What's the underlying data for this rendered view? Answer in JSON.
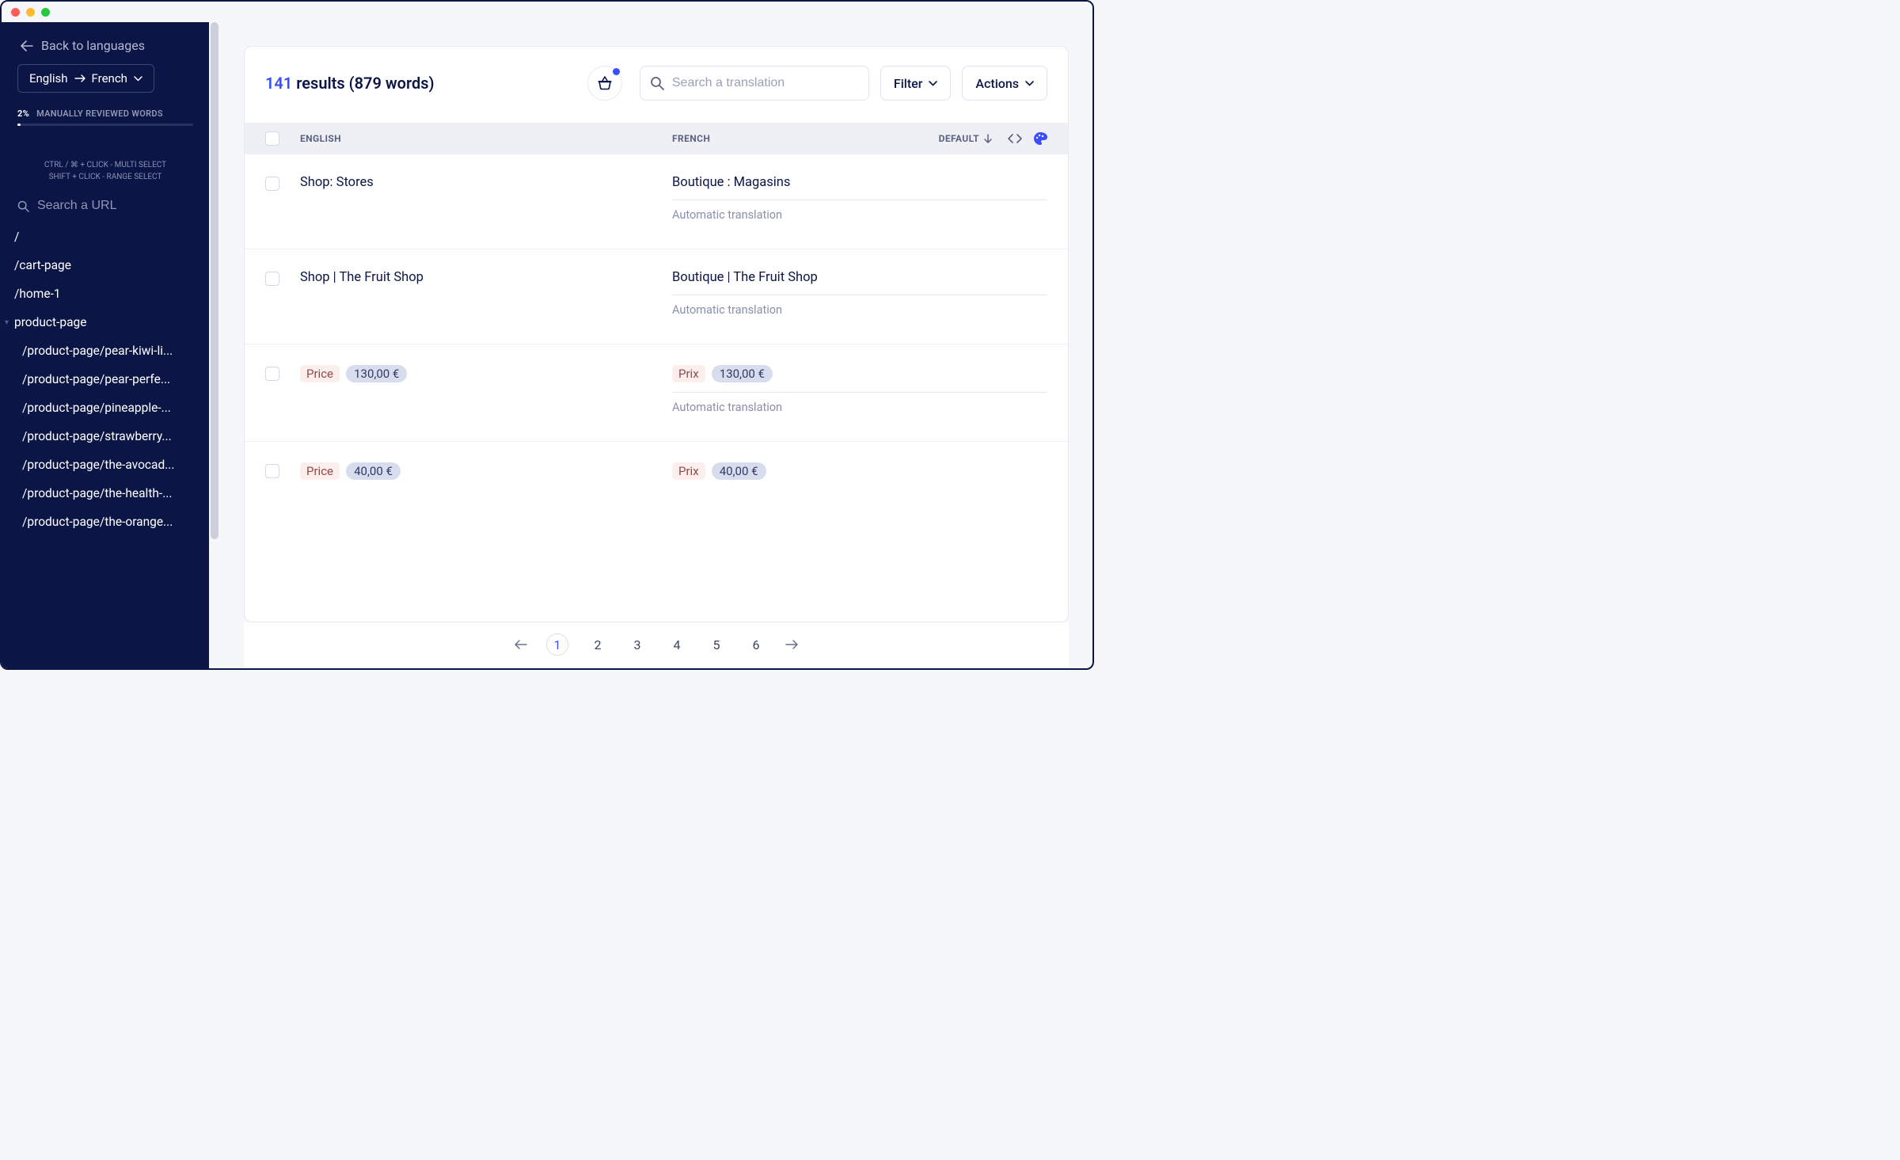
{
  "sidebar": {
    "back_label": "Back to languages",
    "lang_from": "English",
    "lang_to": "French",
    "progress_pct": "2%",
    "progress_label": "MANUALLY REVIEWED WORDS",
    "hint1": "CTRL / ⌘ + CLICK - MULTI SELECT",
    "hint2": "SHIFT + CLICK - RANGE SELECT",
    "url_search_placeholder": "Search a URL",
    "urls": [
      "/",
      "/cart-page",
      "/home-1",
      "product-page",
      "/product-page/pear-kiwi-li...",
      "/product-page/pear-perfe...",
      "/product-page/pineapple-...",
      "/product-page/strawberry...",
      "/product-page/the-avocad...",
      "/product-page/the-health-...",
      "/product-page/the-orange..."
    ]
  },
  "header": {
    "result_count": "141",
    "results_word": "results",
    "words_paren": "(879 words)",
    "search_placeholder": "Search a translation",
    "filter_label": "Filter",
    "actions_label": "Actions"
  },
  "columns": {
    "src": "ENGLISH",
    "dst": "FRENCH",
    "default": "DEFAULT"
  },
  "rows": [
    {
      "src_plain": "Shop: Stores",
      "dst_plain": "Boutique : Magasins",
      "note": "Automatic translation"
    },
    {
      "src_plain": "Shop | The Fruit Shop",
      "dst_plain": "Boutique | The Fruit Shop",
      "note": "Automatic translation"
    },
    {
      "src_chip_label": "Price",
      "src_chip_value": "130,00 €",
      "dst_chip_label": "Prix",
      "dst_chip_value": "130,00 €",
      "note": "Automatic translation"
    },
    {
      "src_chip_label": "Price",
      "src_chip_value": "40,00 €",
      "dst_chip_label": "Prix",
      "dst_chip_value": "40,00 €",
      "note": ""
    }
  ],
  "pagination": {
    "pages": [
      "1",
      "2",
      "3",
      "4",
      "5",
      "6"
    ],
    "active": "1"
  }
}
